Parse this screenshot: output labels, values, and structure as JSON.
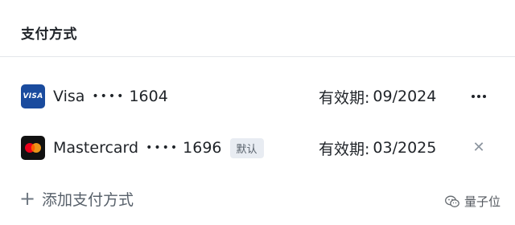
{
  "section": {
    "title": "支付方式"
  },
  "cards": [
    {
      "brand_icon": "visa-logo-icon",
      "brand_logo_text": "VISA",
      "name": "Visa",
      "dots": "••••",
      "last4": "1604",
      "badge": "",
      "expiry_label": "有效期:",
      "expiry": "09/2024",
      "action_icon": "more-horizontal-icon"
    },
    {
      "brand_icon": "mastercard-logo-icon",
      "name": "Mastercard",
      "dots": "••••",
      "last4": "1696",
      "badge": "默认",
      "expiry_label": "有效期:",
      "expiry": "03/2025",
      "action_icon": "close-icon"
    }
  ],
  "add_payment": {
    "icon": "plus-icon",
    "label": "添加支付方式"
  },
  "watermark": {
    "icon": "wechat-icon",
    "text": "量子位"
  },
  "colors": {
    "visa_blue": "#1a4b9e",
    "mastercard_red": "#eb001b",
    "mastercard_orange": "#f79e1b",
    "badge_bg": "#e8ecf2",
    "divider": "#e4e6ea"
  }
}
